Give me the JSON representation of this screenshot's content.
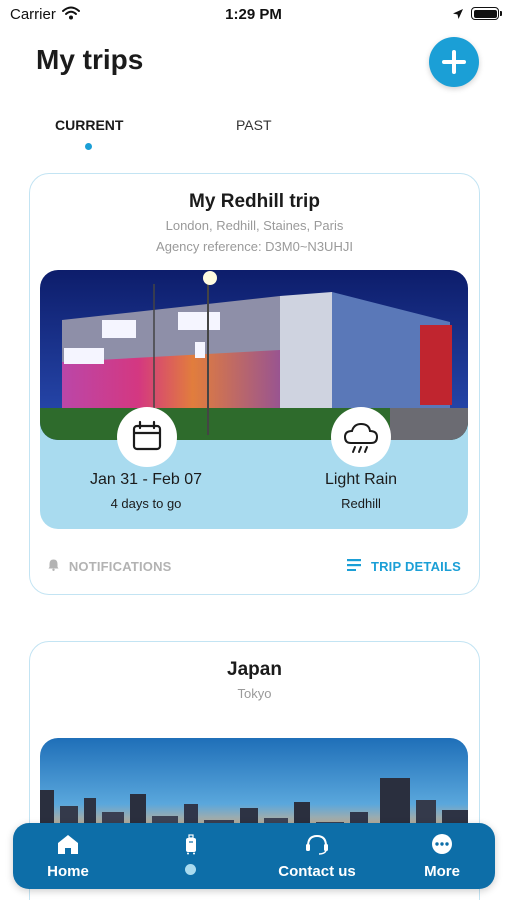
{
  "status_bar": {
    "carrier": "Carrier",
    "time": "1:29 PM",
    "icons": [
      "wifi-icon",
      "location-arrow-icon",
      "battery-icon"
    ]
  },
  "header": {
    "title": "My trips",
    "add_icon": "plus-icon"
  },
  "tabs": [
    {
      "label": "CURRENT",
      "active": true
    },
    {
      "label": "PAST",
      "active": false
    }
  ],
  "trips": [
    {
      "title": "My Redhill trip",
      "locations": "London, Redhill, Staines, Paris",
      "agency_reference": "Agency reference: D3M0~N3UHJI",
      "dates": "Jan 31 - Feb 07",
      "countdown": "4 days to go",
      "weather": "Light Rain",
      "weather_location": "Redhill",
      "dates_icon": "calendar-icon",
      "weather_icon": "cloud-rain-icon",
      "notifications_label": "NOTIFICATIONS",
      "notifications_icon": "bell-icon",
      "details_label": "TRIP DETAILS",
      "details_icon": "list-icon"
    },
    {
      "title": "Japan",
      "locations": "Tokyo"
    }
  ],
  "bottom_nav": [
    {
      "label": "Home",
      "icon": "home-icon"
    },
    {
      "label": "",
      "icon": "luggage-icon",
      "active_dot": true
    },
    {
      "label": "Contact us",
      "icon": "headset-icon"
    },
    {
      "label": "More",
      "icon": "more-dots-icon"
    }
  ],
  "colors": {
    "accent": "#1b9fd6",
    "nav_background": "#0d6ea8",
    "info_panel": "#a9dbef",
    "card_border": "#c3e4f3",
    "muted_text": "#9a9a9a"
  }
}
